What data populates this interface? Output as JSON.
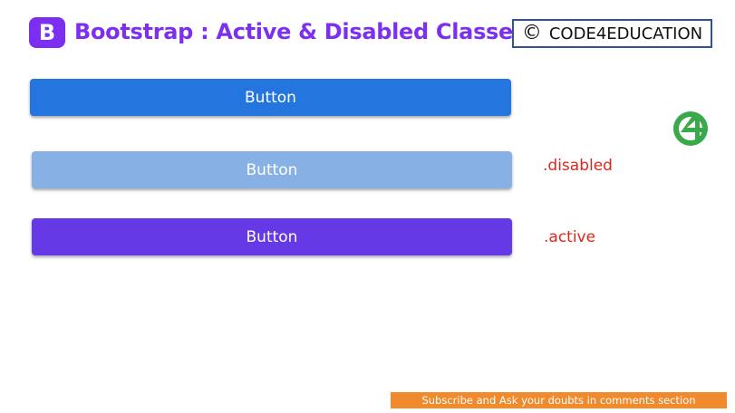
{
  "header": {
    "logo_letter": "B",
    "title": "Bootstrap : Active & Disabled Classes",
    "copyright_symbol": "©",
    "copyright_text": "CODE4EDUCATION"
  },
  "buttons": [
    {
      "label": "Button",
      "state": "default",
      "color": "#2475de",
      "class_label": ""
    },
    {
      "label": "Button",
      "state": "disabled",
      "color": "#87b1e4",
      "class_label": ".disabled"
    },
    {
      "label": "Button",
      "state": "active",
      "color": "#6639e6",
      "class_label": ".active"
    }
  ],
  "brand_icon": {
    "name": "code4education-logo-icon",
    "color": "#3aa94a"
  },
  "footer": {
    "subscribe_text": "Subscribe and Ask your doubts in comments section",
    "color": "#f08a2c"
  }
}
